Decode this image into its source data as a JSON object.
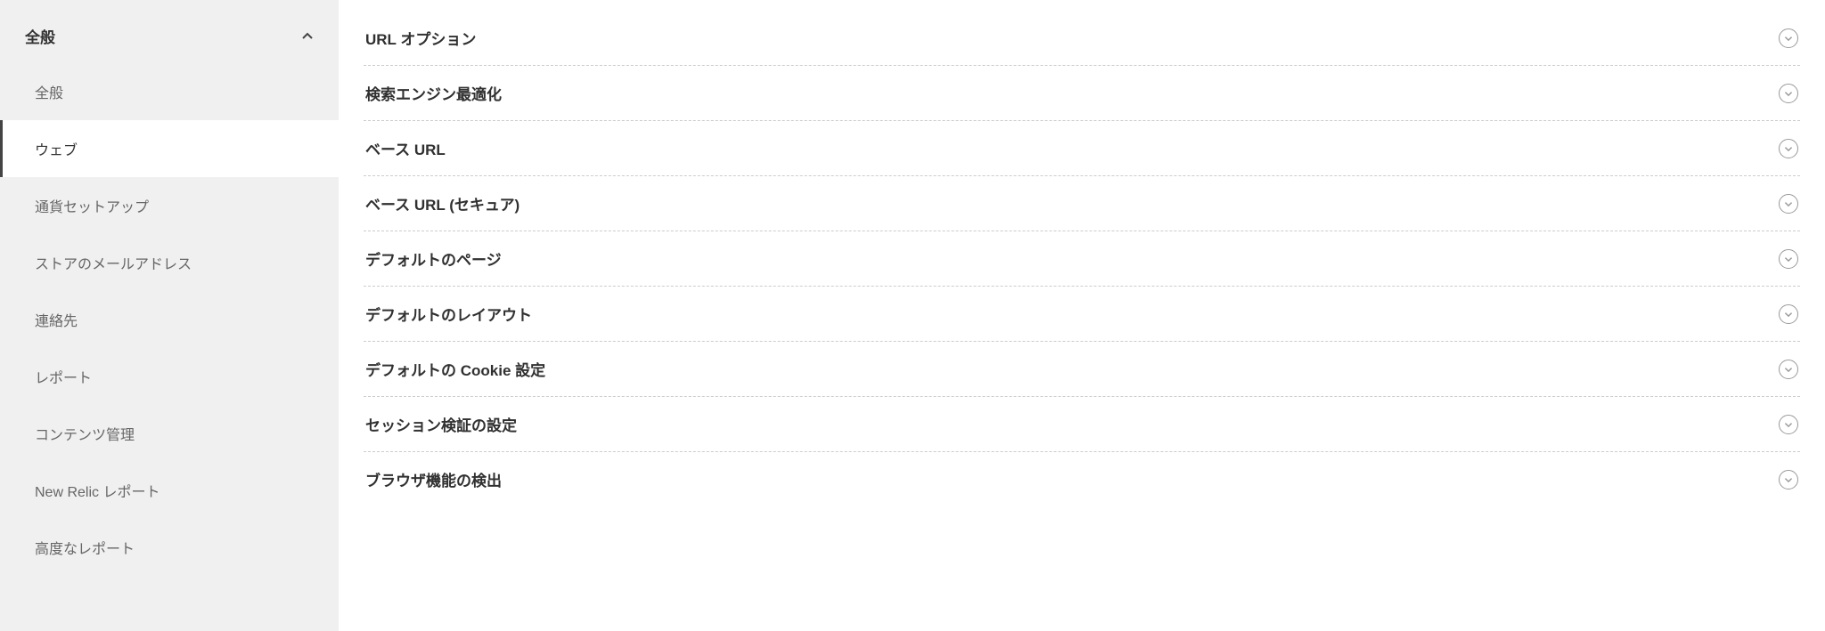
{
  "sidebar": {
    "header": "全般",
    "items": [
      {
        "label": "全般",
        "selected": false
      },
      {
        "label": "ウェブ",
        "selected": true
      },
      {
        "label": "通貨セットアップ",
        "selected": false
      },
      {
        "label": "ストアのメールアドレス",
        "selected": false
      },
      {
        "label": "連絡先",
        "selected": false
      },
      {
        "label": "レポート",
        "selected": false
      },
      {
        "label": "コンテンツ管理",
        "selected": false
      },
      {
        "label": "New Relic レポート",
        "selected": false
      },
      {
        "label": "高度なレポート",
        "selected": false
      }
    ]
  },
  "sections": [
    {
      "title": "URL オプション"
    },
    {
      "title": "検索エンジン最適化"
    },
    {
      "title": "ベース URL"
    },
    {
      "title": "ベース URL (セキュア)"
    },
    {
      "title": "デフォルトのページ"
    },
    {
      "title": "デフォルトのレイアウト"
    },
    {
      "title": "デフォルトの Cookie 設定"
    },
    {
      "title": "セッション検証の設定"
    },
    {
      "title": "ブラウザ機能の検出"
    }
  ]
}
